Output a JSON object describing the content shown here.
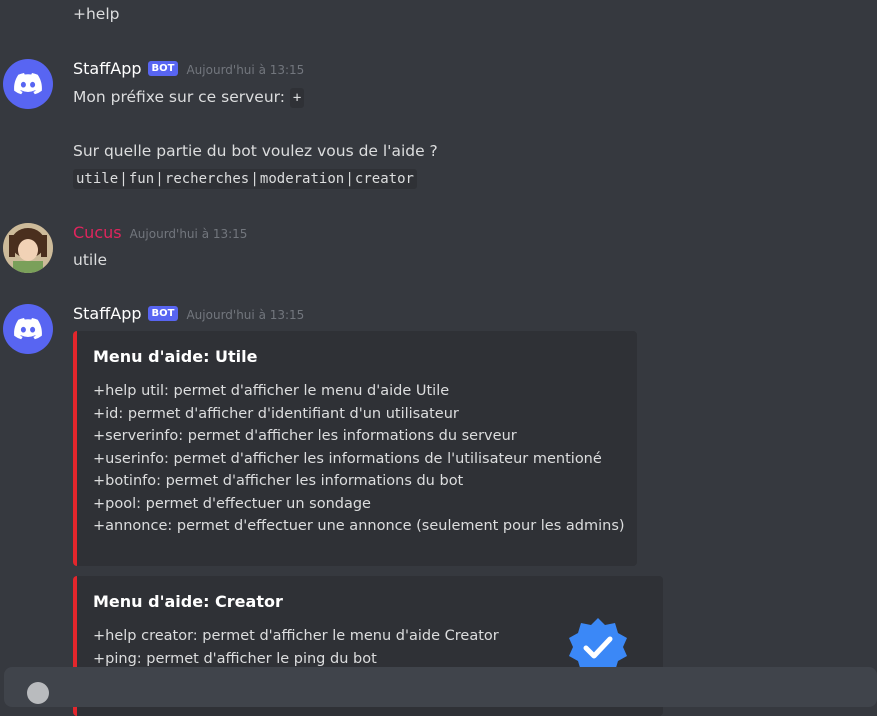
{
  "top_message": {
    "text": "+help"
  },
  "messages": [
    {
      "author": "StaffApp",
      "bot_tag": "BOT",
      "timestamp": "Aujourd'hui à 13:15",
      "line1": "Mon préfixe sur ce serveur:",
      "prefix": "+",
      "line2": "Sur quelle partie du bot voulez vous de l'aide ?",
      "categories": [
        "utile",
        "fun",
        "recherches",
        "moderation",
        "creator"
      ],
      "separator": "|"
    },
    {
      "author": "Cucus",
      "timestamp": "Aujourd'hui à 13:15",
      "text": "utile"
    },
    {
      "author": "StaffApp",
      "bot_tag": "BOT",
      "timestamp": "Aujourd'hui à 13:15",
      "embeds": [
        {
          "title": "Menu d'aide: Utile",
          "lines": [
            "+help util: permet d'afficher le menu d'aide Utile",
            "+id: permet d'afficher d'identifiant d'un utilisateur",
            "+serverinfo: permet d'afficher les informations du serveur",
            "+userinfo: permet d'afficher les informations de l'utilisateur mentioné",
            "+botinfo: permet d'afficher les informations du bot",
            "+pool: permet d'effectuer un sondage",
            "+annonce: permet d'effectuer une annonce (seulement pour les admins)"
          ]
        },
        {
          "title": "Menu d'aide: Creator",
          "lines": [
            "+help creator: permet d'afficher le menu d'aide Creator",
            "+ping: permet d'afficher le ping du bot"
          ]
        }
      ]
    }
  ],
  "colors": {
    "background": "#36393f",
    "bot_badge": "#5865f2",
    "embed_border": "#e3262c",
    "cucus_name": "#e0255d",
    "verified_badge": "#3b88f7"
  },
  "icons": {
    "bot_avatar": "discord-logo-icon",
    "verified": "verified-check-icon",
    "attach": "plus-circle-icon"
  }
}
